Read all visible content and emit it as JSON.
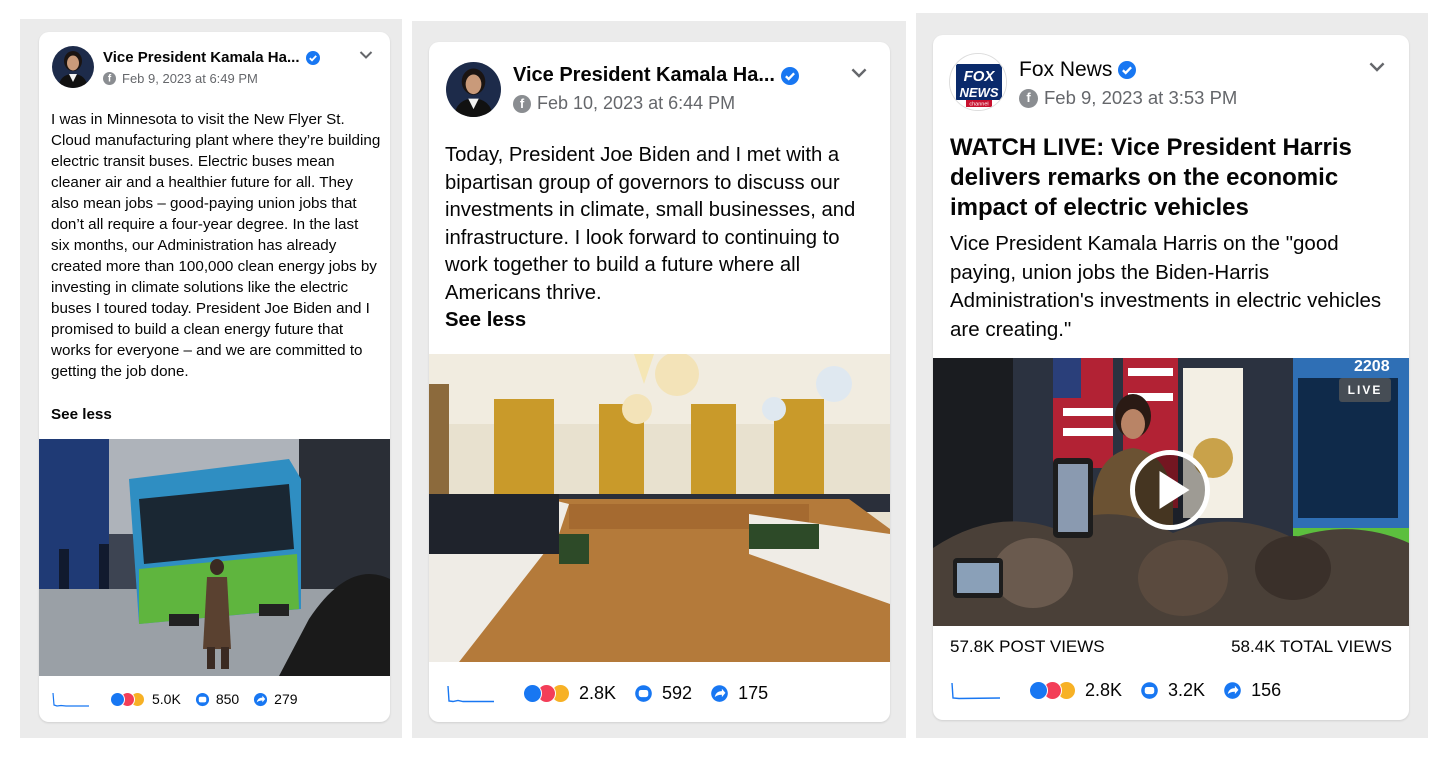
{
  "posts": [
    {
      "author": "Vice President Kamala Ha...",
      "date": "Feb 9, 2023 at 6:49 PM",
      "text": "I was in Minnesota to visit the New Flyer St. Cloud manufacturing plant where they’re building electric transit buses. Electric buses mean cleaner air and a healthier future for all. They also mean jobs – good-paying union jobs that don’t all require a four-year degree. In the last six months, our Administration has already created more than 100,000 clean energy jobs by investing in climate solutions like the electric buses I toured today. President Joe Biden and I promised to build a clean energy future that works for everyone – and we are committed to getting the job done.",
      "see_less": "See less",
      "reactions": "5.0K",
      "comments": "850",
      "shares": "279"
    },
    {
      "author": "Vice President Kamala Ha...",
      "date": "Feb 10, 2023 at 6:44 PM",
      "text": "Today, President Joe Biden and I met with a bipartisan group of governors to discuss our investments in climate, small businesses, and infrastructure. I look forward to continuing to work together to build a future where all Americans thrive.",
      "see_less": "See less",
      "reactions": "2.8K",
      "comments": "592",
      "shares": "175"
    },
    {
      "author": "Fox News",
      "date": "Feb 9, 2023 at 3:53 PM",
      "headline": "WATCH LIVE: Vice President Harris delivers remarks on the economic impact of electric vehicles",
      "text": "Vice President Kamala Harris on the \"good paying, union jobs the Biden-Harris Administration's investments in electric vehicles are creating.\"",
      "live_label": "LIVE",
      "bus_number": "2208",
      "post_views": "57.8K POST VIEWS",
      "total_views": "58.4K TOTAL VIEWS",
      "reactions": "2.8K",
      "comments": "3.2K",
      "shares": "156"
    }
  ],
  "logo": {
    "line1": "FOX",
    "line2": "NEWS",
    "line3": "channel"
  },
  "colors": {
    "verified": "#1877f2",
    "like": "#1877f2",
    "love": "#f33e58",
    "haha": "#f7b125",
    "background_panel": "#ebebeb",
    "meta_gray": "#65676b",
    "sparkline": "#1877f2"
  },
  "icons": {
    "verified": "verified-badge-icon",
    "globe": "facebook-icon",
    "chevron": "chevron-down-icon",
    "comment": "comment-icon",
    "share": "share-icon",
    "play": "play-icon"
  }
}
